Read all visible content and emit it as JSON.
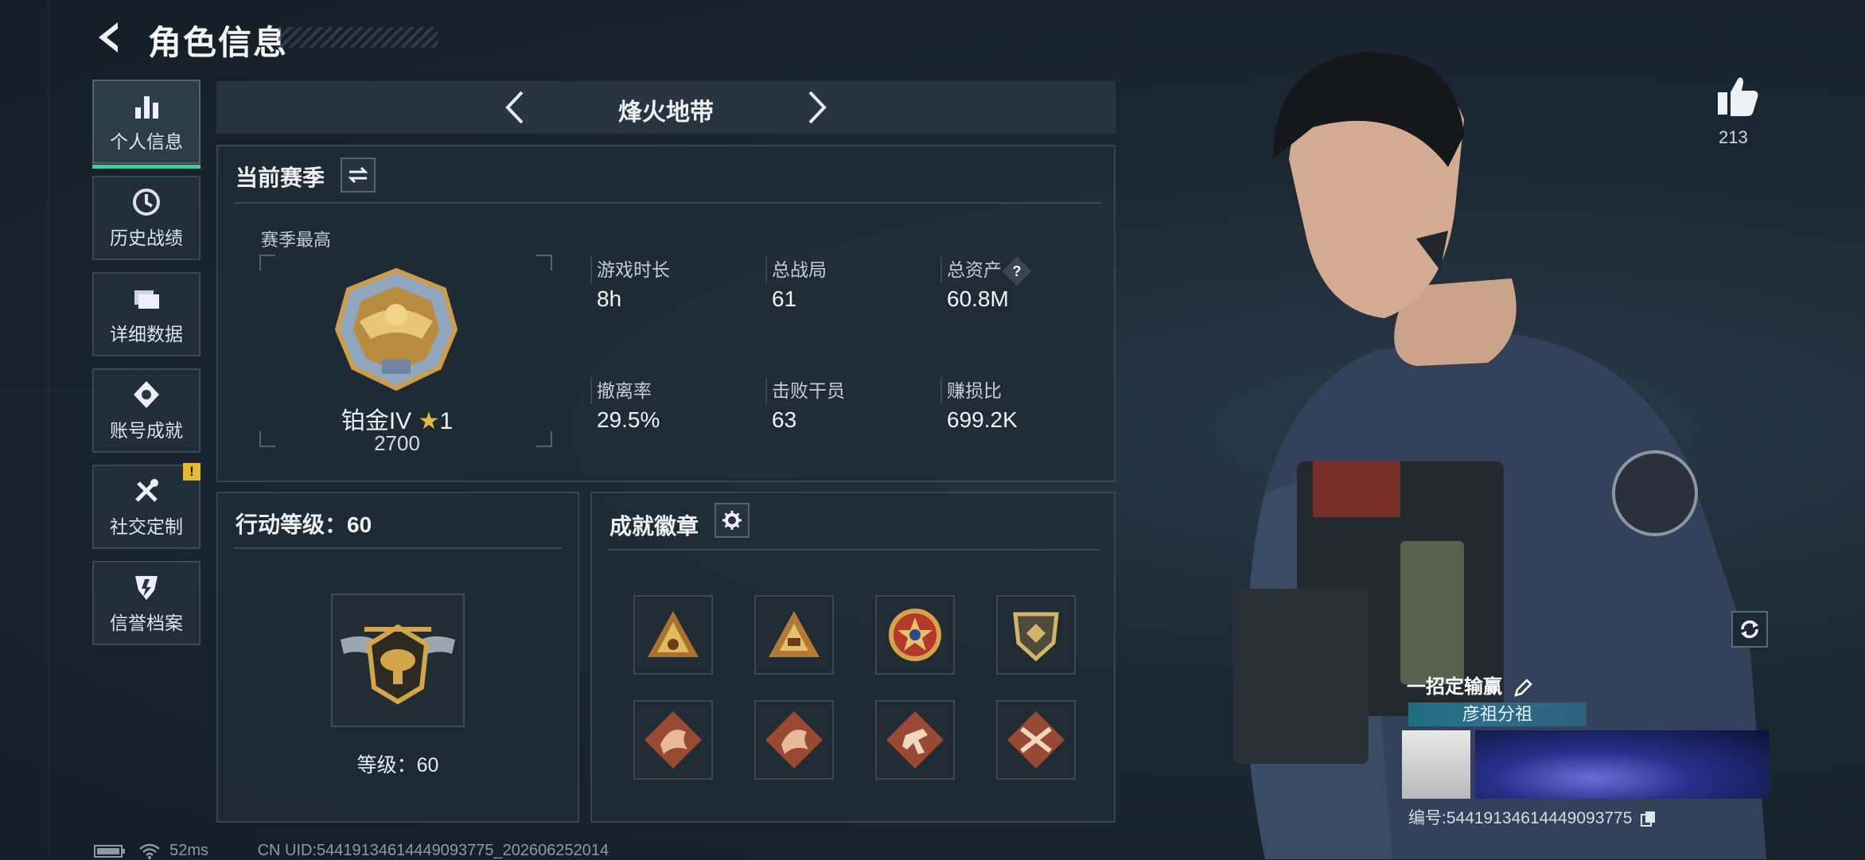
{
  "header": {
    "title": "角色信息"
  },
  "sidebar": {
    "items": [
      {
        "label": "个人信息",
        "icon": "bar-chart-icon",
        "active": true
      },
      {
        "label": "历史战绩",
        "icon": "clock-icon"
      },
      {
        "label": "详细数据",
        "icon": "folder-icon"
      },
      {
        "label": "账号成就",
        "icon": "medal-icon"
      },
      {
        "label": "社交定制",
        "icon": "tools-icon",
        "alert": "!"
      },
      {
        "label": "信誉档案",
        "icon": "shield-icon"
      }
    ]
  },
  "mode": {
    "name": "烽火地带"
  },
  "season": {
    "title": "当前赛季",
    "best_label": "赛季最高",
    "rank_name": "铂金IV",
    "rank_star": "★",
    "rank_stars": "1",
    "rank_score": "2700",
    "stats": [
      {
        "label": "游戏时长",
        "value": "8h"
      },
      {
        "label": "总战局",
        "value": "61"
      },
      {
        "label": "总资产",
        "value": "60.8M",
        "help": "?"
      },
      {
        "label": "撤离率",
        "value": "29.5%"
      },
      {
        "label": "击败干员",
        "value": "63"
      },
      {
        "label": "赚损比",
        "value": "699.2K"
      }
    ]
  },
  "level": {
    "title": "行动等级：60",
    "level_text": "等级：60"
  },
  "achievements": {
    "title": "成就徽章",
    "badges": [
      "pyramid-badge-icon",
      "triangle-badge-icon",
      "star-wreath-badge-icon",
      "shield-badge-icon",
      "dragon-badge-icon",
      "dragon-badge-icon",
      "runner-badge-icon",
      "crossed-guns-badge-icon"
    ]
  },
  "profile": {
    "likes": "213",
    "nickname": "一招定输赢",
    "guild": "彦祖分祖",
    "id_line": "编号:5441913461444909377​5"
  },
  "status": {
    "ping": "52ms",
    "uid": "CN UID:54419134614449093775_202606252014"
  },
  "colors": {
    "accent": "#35d49a",
    "alert": "#e3b93a",
    "guild": "#2f6d8c"
  }
}
